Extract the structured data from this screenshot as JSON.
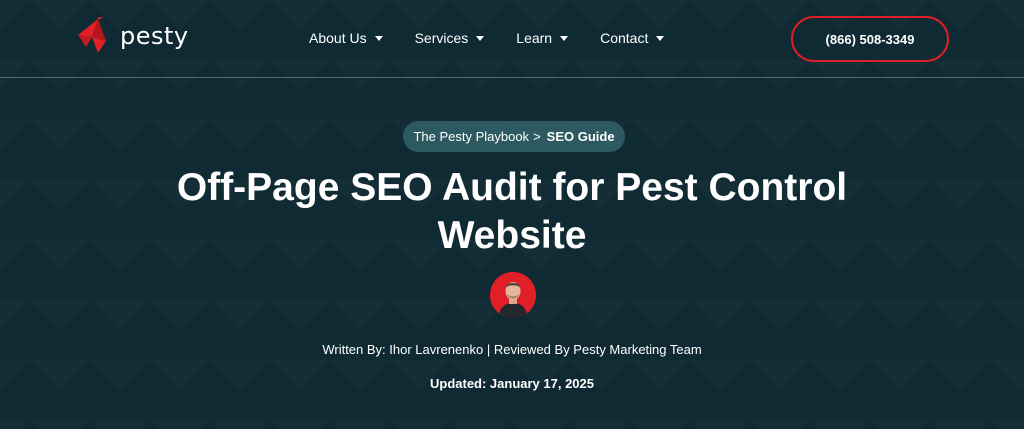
{
  "brand": {
    "name": "pesty",
    "accent": "#e01f26",
    "background": "#0f2a33"
  },
  "nav": {
    "items": [
      {
        "label": "About Us"
      },
      {
        "label": "Services"
      },
      {
        "label": "Learn"
      },
      {
        "label": "Contact"
      }
    ]
  },
  "header": {
    "phone": "(866) 508-3349"
  },
  "breadcrumb": {
    "parent": "The Pesty Playbook",
    "separator": ">",
    "current": "SEO Guide"
  },
  "article": {
    "title_line1": "Off-Page SEO Audit for Pest Control",
    "title_line2": "Website",
    "byline": "Written By: Ihor Lavrenenko | Reviewed By Pesty Marketing Team",
    "updated": "Updated: January 17, 2025"
  },
  "icons": {
    "logo": "pesty-logo-icon",
    "dropdown": "chevron-down-icon",
    "author": "author-avatar"
  }
}
